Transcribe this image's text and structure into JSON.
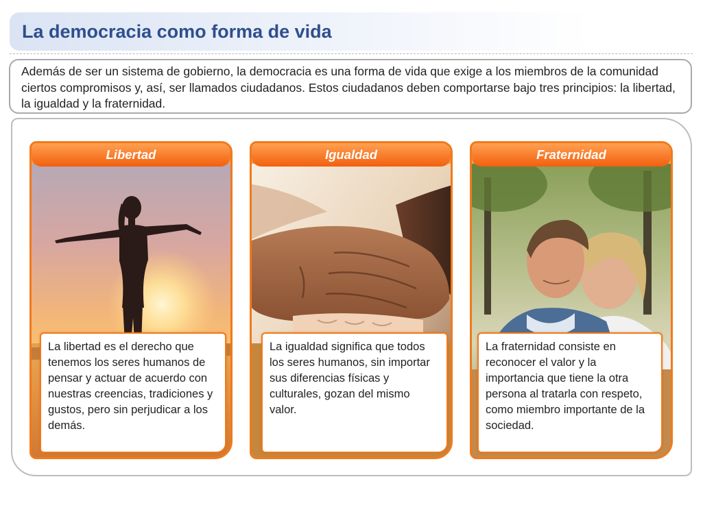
{
  "header": {
    "title": "La democracia como forma de vida"
  },
  "intro": {
    "text": "Además de ser un sistema de gobierno, la democracia es una forma de vida que exige a los miembros de la comunidad ciertos compromisos y, así, ser llamados ciudadanos. Estos ciudadanos deben comportarse bajo tres principios: la libertad, la igualdad y la fraternidad."
  },
  "cards": [
    {
      "title": "Libertad",
      "image": "silhouette-sunset-photo",
      "text": "La libertad es el derecho que tenemos los seres humanos de pensar y actuar de acuerdo con nuestras creencias, tradiciones y gustos, pero sin perjudicar a los demás."
    },
    {
      "title": "Igualdad",
      "image": "joined-hands-photo",
      "text": "La igualdad significa que todos los seres humanos, sin importar sus diferencias físicas y culturales, gozan del mismo valor."
    },
    {
      "title": "Fraternidad",
      "image": "embracing-couple-photo",
      "text": "La fraternidad consiste en reconocer el valor y la importancia que tiene la otra persona al tratarla con respeto, como miembro importante de la sociedad."
    }
  ],
  "colors": {
    "title_text": "#2e4f8c",
    "card_accent": "#f07a1c",
    "header_orange": "#f25f0e"
  }
}
